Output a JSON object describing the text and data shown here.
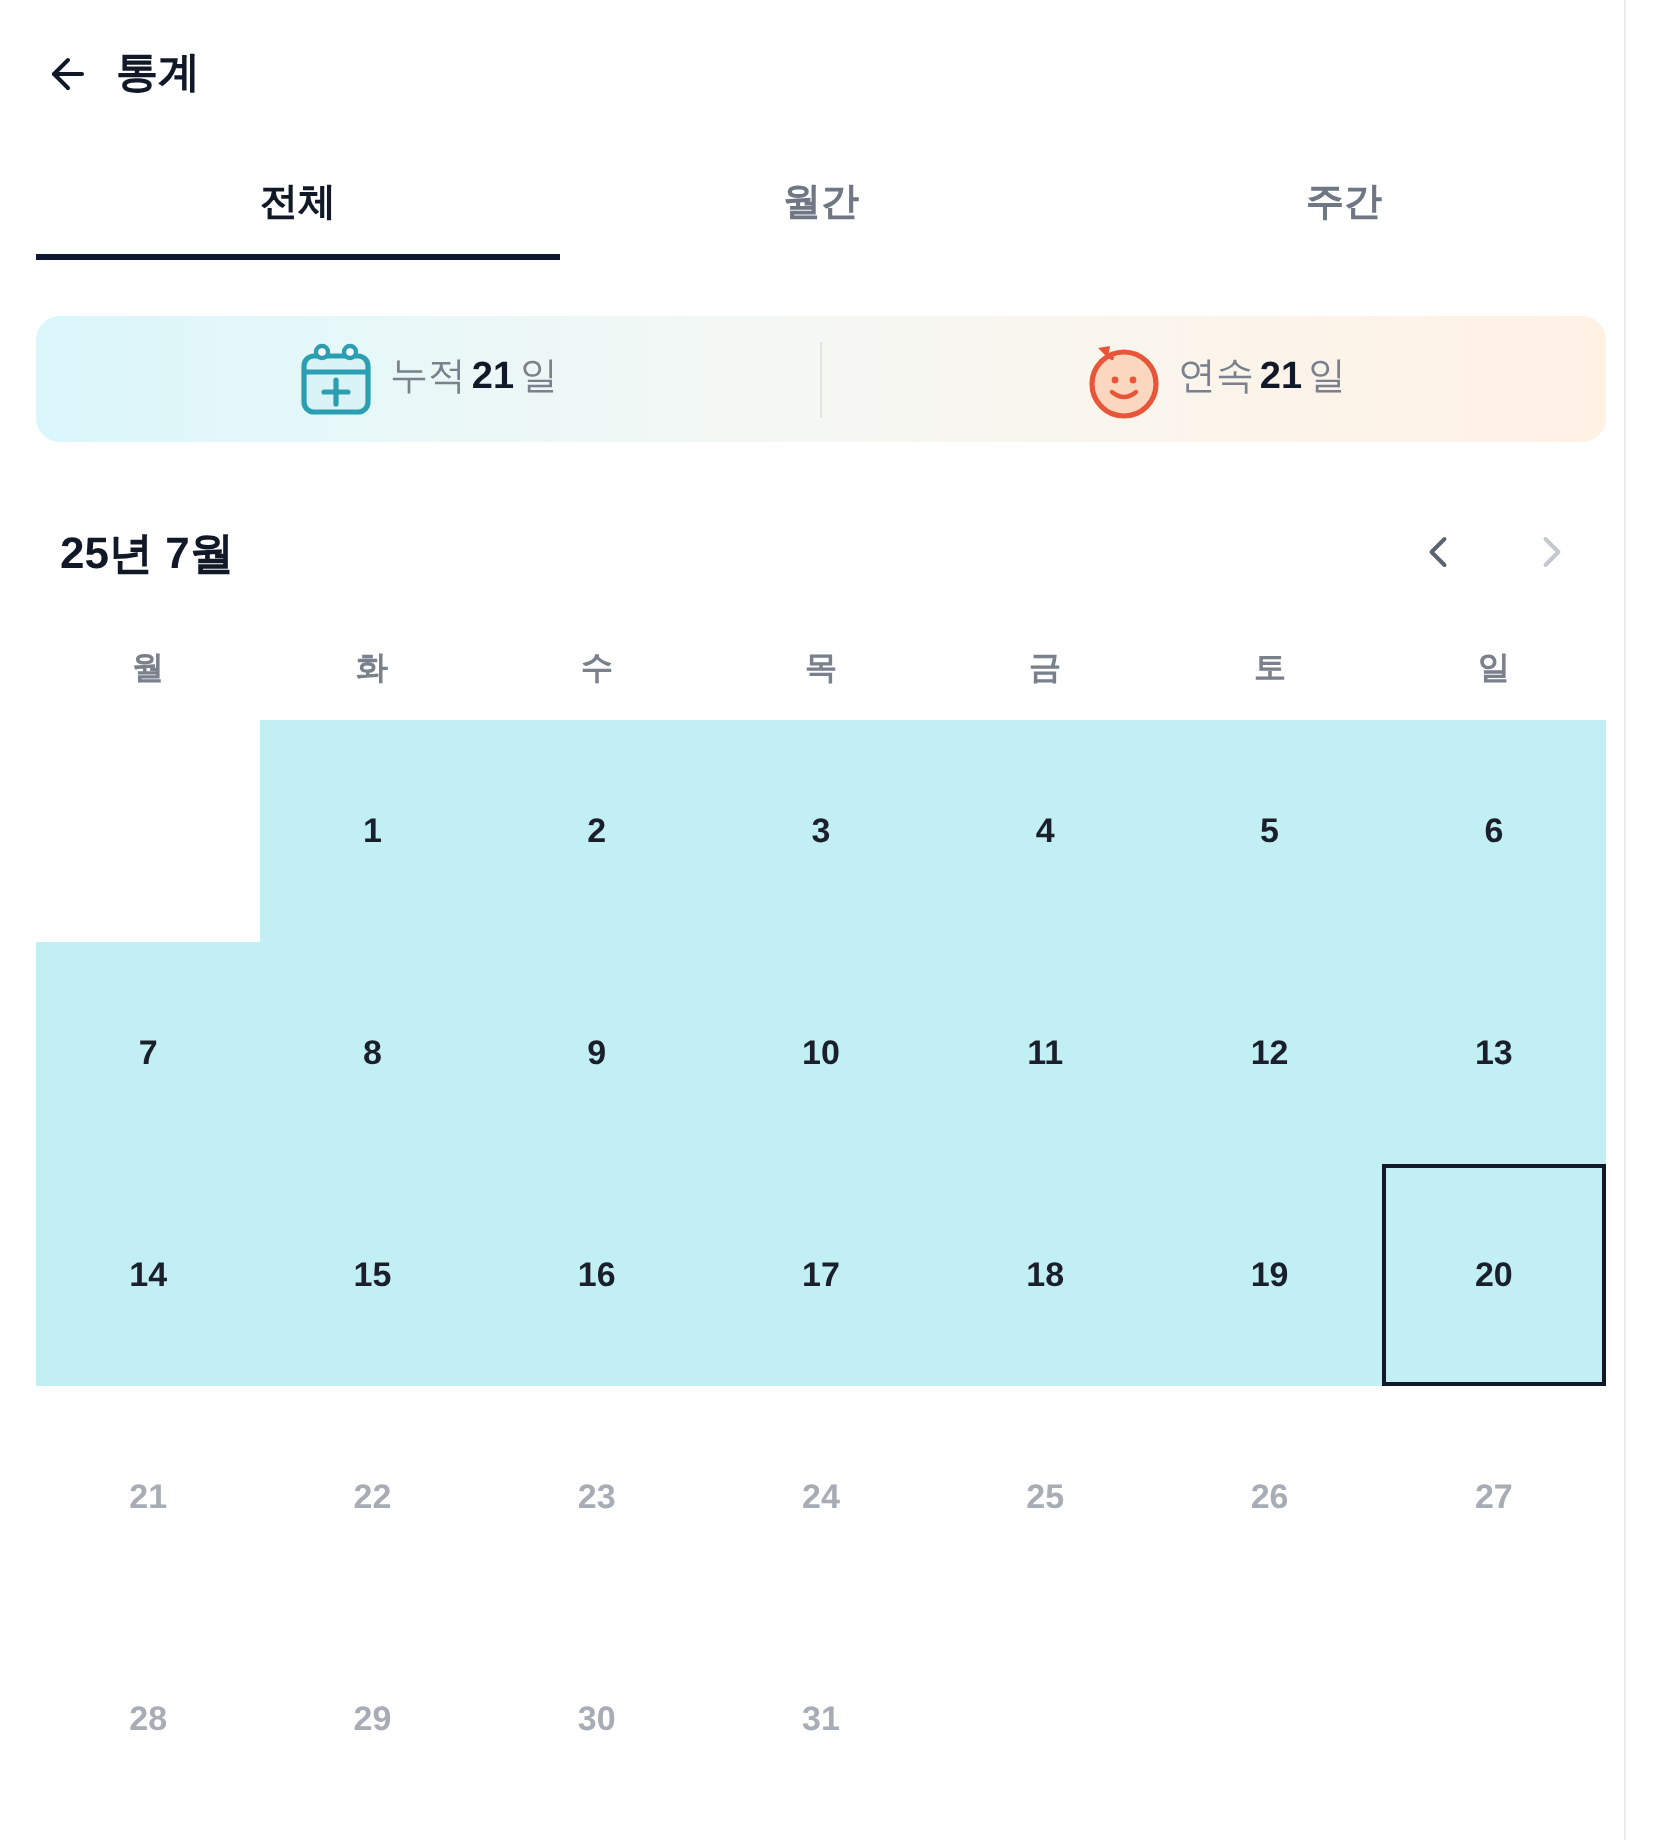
{
  "header": {
    "title": "통계"
  },
  "tabs": [
    {
      "label": "전체",
      "selected": true
    },
    {
      "label": "월간",
      "selected": false
    },
    {
      "label": "주간",
      "selected": false
    }
  ],
  "stats": [
    {
      "kind": "total",
      "label": "누적",
      "value": "21",
      "unit": "일"
    },
    {
      "kind": "streak",
      "label": "연속",
      "value": "21",
      "unit": "일"
    }
  ],
  "calendar": {
    "title": "25년 7월",
    "nav": [
      {
        "kind": "prev",
        "disabled": false
      },
      {
        "kind": "next",
        "disabled": true
      }
    ],
    "weekdays": [
      "월",
      "화",
      "수",
      "목",
      "금",
      "토",
      "일"
    ],
    "weeks": [
      {
        "days": [
          {
            "kind": "blank"
          },
          {
            "kind": "day",
            "label": "1",
            "recorded": true,
            "selected": false,
            "disabled": false
          },
          {
            "kind": "day",
            "label": "2",
            "recorded": true,
            "selected": false,
            "disabled": false
          },
          {
            "kind": "day",
            "label": "3",
            "recorded": true,
            "selected": false,
            "disabled": false
          },
          {
            "kind": "day",
            "label": "4",
            "recorded": true,
            "selected": false,
            "disabled": false
          },
          {
            "kind": "day",
            "label": "5",
            "recorded": true,
            "selected": false,
            "disabled": false
          },
          {
            "kind": "day",
            "label": "6",
            "recorded": true,
            "selected": false,
            "disabled": false
          }
        ]
      },
      {
        "days": [
          {
            "kind": "day",
            "label": "7",
            "recorded": true,
            "selected": false,
            "disabled": false
          },
          {
            "kind": "day",
            "label": "8",
            "recorded": true,
            "selected": false,
            "disabled": false
          },
          {
            "kind": "day",
            "label": "9",
            "recorded": true,
            "selected": false,
            "disabled": false
          },
          {
            "kind": "day",
            "label": "10",
            "recorded": true,
            "selected": false,
            "disabled": false
          },
          {
            "kind": "day",
            "label": "11",
            "recorded": true,
            "selected": false,
            "disabled": false
          },
          {
            "kind": "day",
            "label": "12",
            "recorded": true,
            "selected": false,
            "disabled": false
          },
          {
            "kind": "day",
            "label": "13",
            "recorded": true,
            "selected": false,
            "disabled": false
          }
        ]
      },
      {
        "days": [
          {
            "kind": "day",
            "label": "14",
            "recorded": true,
            "selected": false,
            "disabled": false
          },
          {
            "kind": "day",
            "label": "15",
            "recorded": true,
            "selected": false,
            "disabled": false
          },
          {
            "kind": "day",
            "label": "16",
            "recorded": true,
            "selected": false,
            "disabled": false
          },
          {
            "kind": "day",
            "label": "17",
            "recorded": true,
            "selected": false,
            "disabled": false
          },
          {
            "kind": "day",
            "label": "18",
            "recorded": true,
            "selected": false,
            "disabled": false
          },
          {
            "kind": "day",
            "label": "19",
            "recorded": true,
            "selected": false,
            "disabled": false
          },
          {
            "kind": "day",
            "label": "20",
            "recorded": true,
            "selected": true,
            "disabled": false
          }
        ]
      },
      {
        "days": [
          {
            "kind": "day",
            "label": "21",
            "recorded": false,
            "selected": false,
            "disabled": true
          },
          {
            "kind": "day",
            "label": "22",
            "recorded": false,
            "selected": false,
            "disabled": true
          },
          {
            "kind": "day",
            "label": "23",
            "recorded": false,
            "selected": false,
            "disabled": true
          },
          {
            "kind": "day",
            "label": "24",
            "recorded": false,
            "selected": false,
            "disabled": true
          },
          {
            "kind": "day",
            "label": "25",
            "recorded": false,
            "selected": false,
            "disabled": true
          },
          {
            "kind": "day",
            "label": "26",
            "recorded": false,
            "selected": false,
            "disabled": true
          },
          {
            "kind": "day",
            "label": "27",
            "recorded": false,
            "selected": false,
            "disabled": true
          }
        ]
      },
      {
        "days": [
          {
            "kind": "day",
            "label": "28",
            "recorded": false,
            "selected": false,
            "disabled": true
          },
          {
            "kind": "day",
            "label": "29",
            "recorded": false,
            "selected": false,
            "disabled": true
          },
          {
            "kind": "day",
            "label": "30",
            "recorded": false,
            "selected": false,
            "disabled": true
          },
          {
            "kind": "day",
            "label": "31",
            "recorded": false,
            "selected": false,
            "disabled": true
          }
        ]
      }
    ]
  }
}
